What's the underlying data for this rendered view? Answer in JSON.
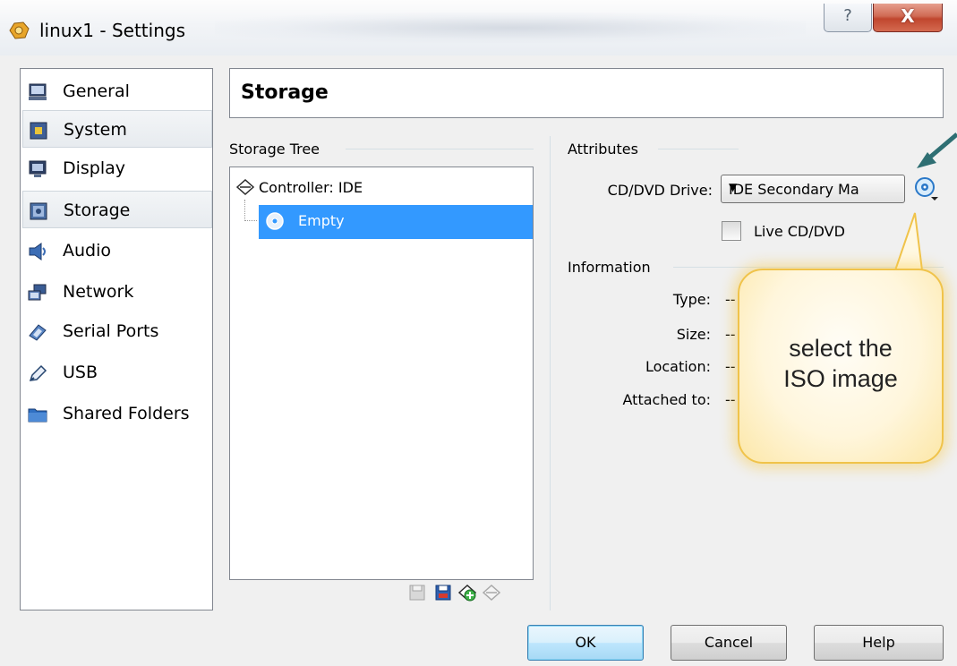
{
  "window": {
    "title": "linux1 - Settings",
    "help_glyph": "?",
    "close_glyph": "X"
  },
  "nav": {
    "items": [
      {
        "label": "General",
        "icon": "monitor-icon"
      },
      {
        "label": "System",
        "icon": "chip-icon"
      },
      {
        "label": "Display",
        "icon": "display-icon"
      },
      {
        "label": "Storage",
        "icon": "storage-icon"
      },
      {
        "label": "Audio",
        "icon": "speaker-icon"
      },
      {
        "label": "Network",
        "icon": "network-icon"
      },
      {
        "label": "Serial Ports",
        "icon": "serial-port-icon"
      },
      {
        "label": "USB",
        "icon": "usb-icon"
      },
      {
        "label": "Shared Folders",
        "icon": "folder-icon"
      }
    ],
    "selected": "Storage"
  },
  "page": {
    "title": "Storage"
  },
  "storage_tree": {
    "title": "Storage Tree",
    "controller": "Controller: IDE",
    "selected_item": "Empty"
  },
  "attributes": {
    "title": "Attributes",
    "cd_dvd_label": "CD/DVD Drive:",
    "cd_dvd_value": "IDE Secondary Ma",
    "live_cd_label": "Live CD/DVD",
    "live_cd_checked": false
  },
  "information": {
    "title": "Information",
    "rows": [
      {
        "label": "Type:",
        "value": "--"
      },
      {
        "label": "Size:",
        "value": "--"
      },
      {
        "label": "Location:",
        "value": "--"
      },
      {
        "label": "Attached to:",
        "value": "--"
      }
    ]
  },
  "buttons": {
    "ok": "OK",
    "cancel": "Cancel",
    "help": "Help"
  },
  "callout": {
    "line1": "select the",
    "line2": "ISO image"
  },
  "colors": {
    "selection": "#3399ff",
    "callout_border": "#f0c34a",
    "arrow": "#2f6f73"
  }
}
